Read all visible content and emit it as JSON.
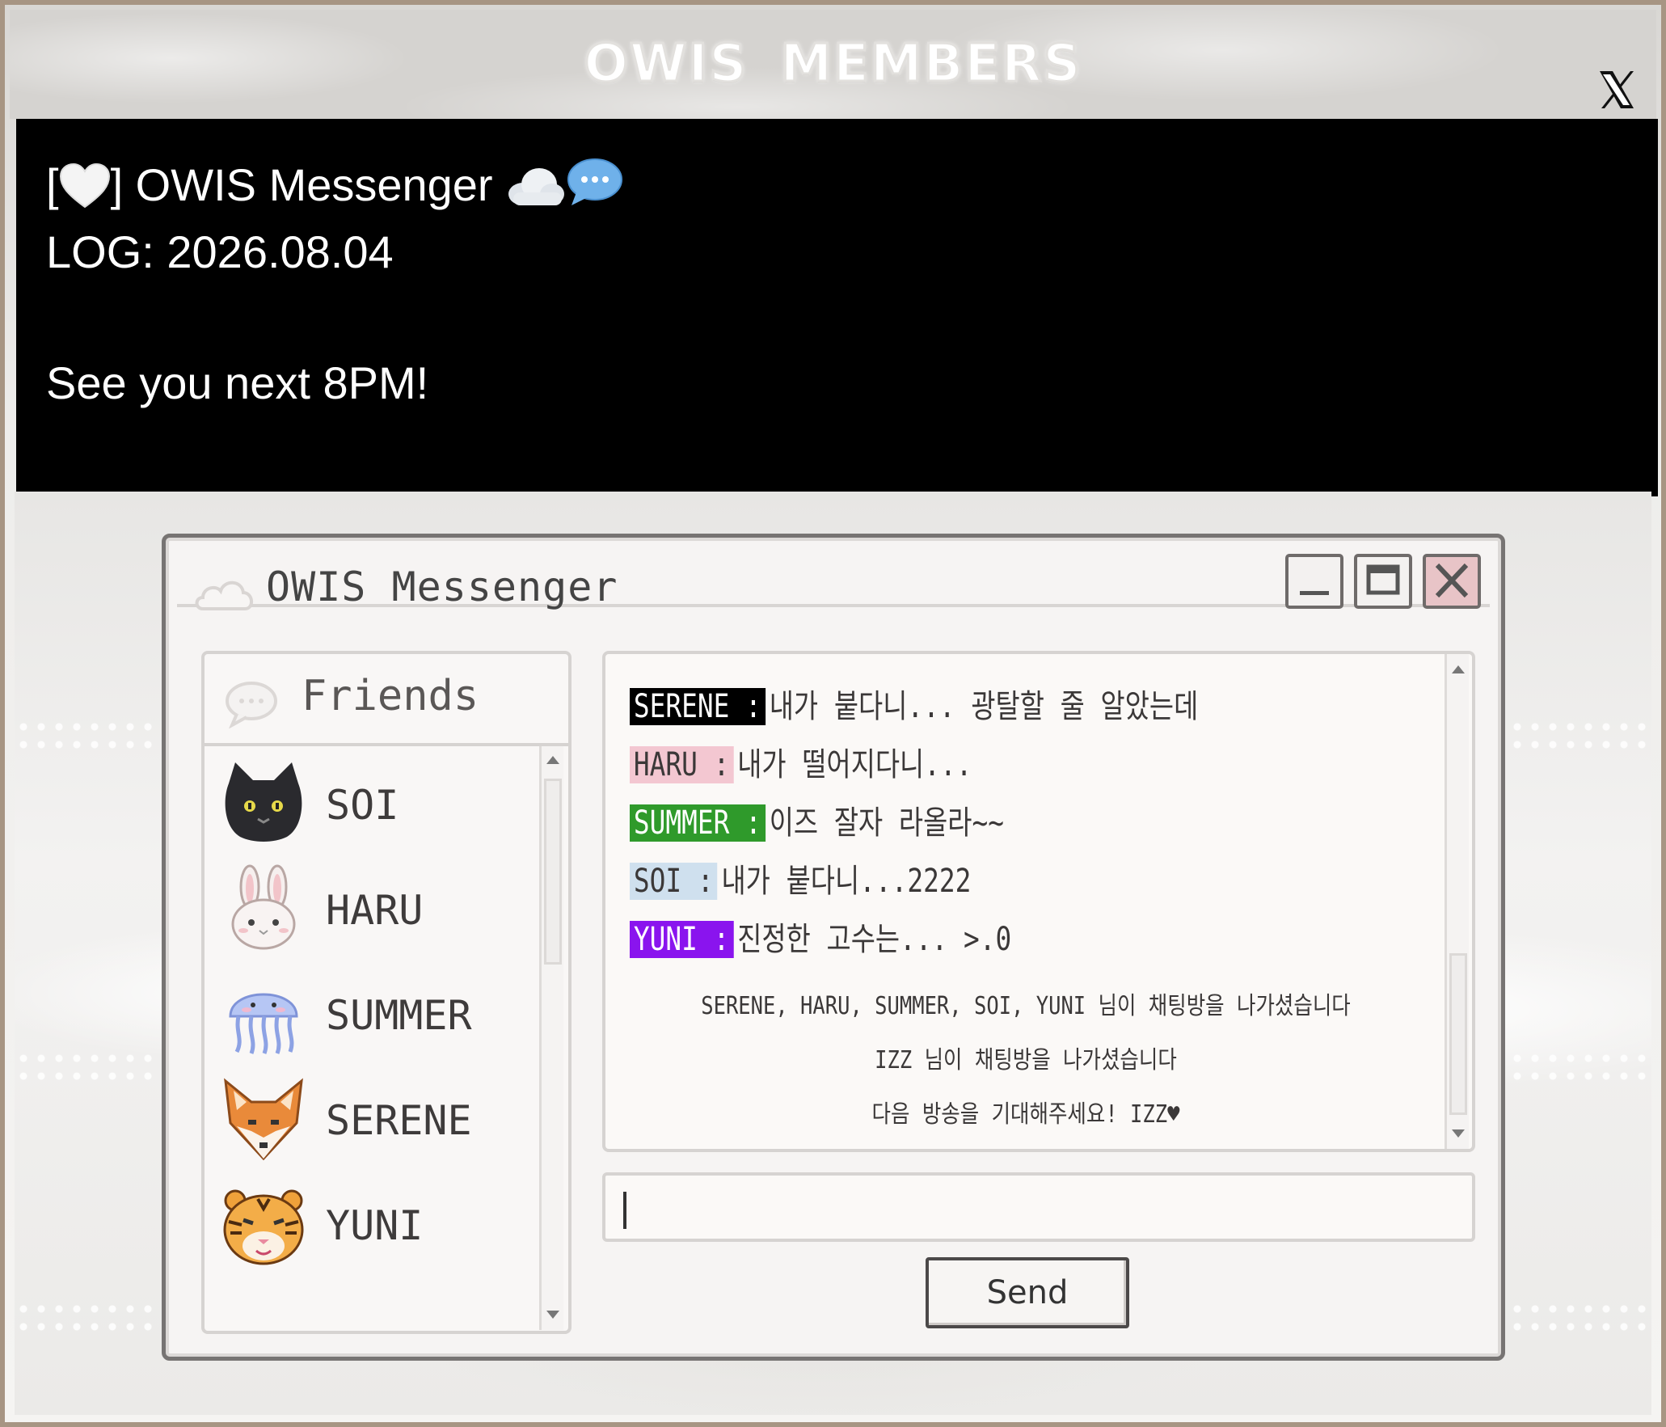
{
  "header": {
    "brand_part1": "OWIS",
    "brand_part2": "MEMBERS",
    "close_label": "X"
  },
  "post": {
    "line1_prefix": "[",
    "line1_suffix": "] OWIS Messenger",
    "line2": "LOG: 2026.08.04",
    "line3": "See you next 8PM!"
  },
  "messenger": {
    "title": "OWIS Messenger",
    "friends_label": "Friends",
    "friends": [
      {
        "name": "SOI",
        "avatar": "cat-icon"
      },
      {
        "name": "HARU",
        "avatar": "rabbit-icon"
      },
      {
        "name": "SUMMER",
        "avatar": "jellyfish-icon"
      },
      {
        "name": "SERENE",
        "avatar": "fox-icon"
      },
      {
        "name": "YUNI",
        "avatar": "tiger-icon"
      }
    ],
    "messages": [
      {
        "tag": "SERENE :",
        "text": "내가 붙다니... 광탈할 줄 알았는데",
        "tag_bg": "#000000",
        "tag_fg": "#ffffff"
      },
      {
        "tag": "HARU :",
        "text": "내가 떨어지다니...",
        "tag_bg": "#f3c7d1",
        "tag_fg": "#3b3838"
      },
      {
        "tag": "SUMMER :",
        "text": "이즈 잘자 라올라~~",
        "tag_bg": "#2f9a2b",
        "tag_fg": "#ffffff"
      },
      {
        "tag": "SOI :",
        "text": "내가 붙다니...2222",
        "tag_bg": "#cfe0ee",
        "tag_fg": "#3b3838"
      },
      {
        "tag": "YUNI :",
        "text": "진정한 고수는... >.0",
        "tag_bg": "#8a14ee",
        "tag_fg": "#ffffff"
      }
    ],
    "system_messages": [
      "SERENE, HARU, SUMMER, SOI, YUNI 님이 채팅방을 나가셨습니다",
      "IZZ 님이 채팅방을 나가셨습니다",
      "다음 방송을 기대해주세요! IZZ♥"
    ],
    "send_label": "Send"
  }
}
